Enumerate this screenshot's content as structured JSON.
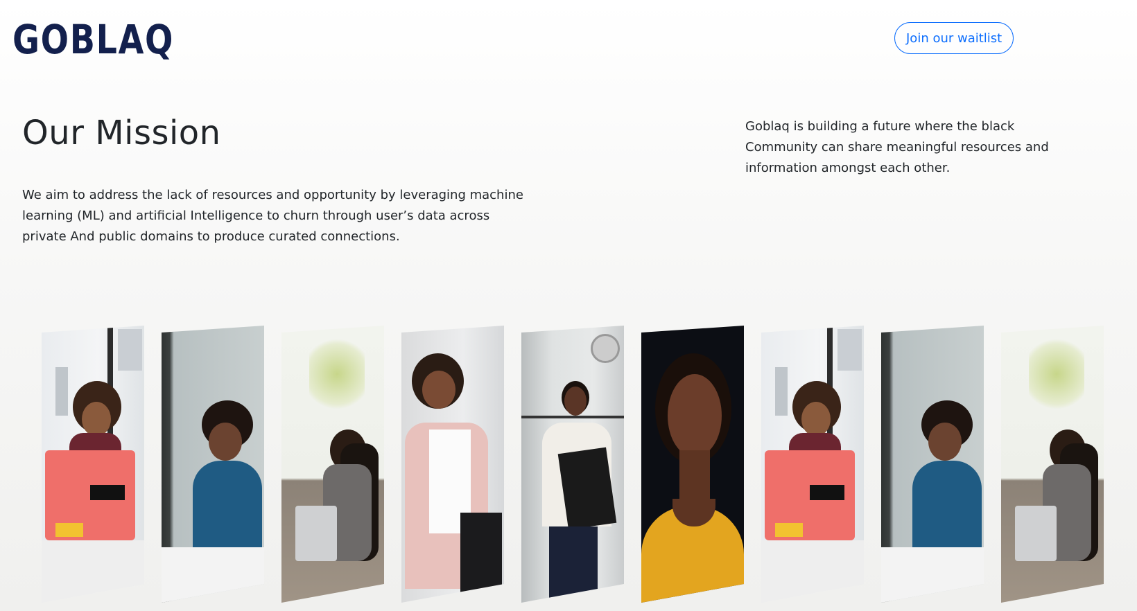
{
  "header": {
    "logo_text": "GOBLAQ",
    "waitlist_label": "Join our waitlist"
  },
  "mission": {
    "title": "Our Mission",
    "body": "We aim to address the lack of resources and opportunity by leveraging machine learning (ML) and artificial Intelligence to churn through user’s data across private And public domains to produce curated connections."
  },
  "vision": {
    "body": "Goblaq is building a future where the black Community can share meaningful resources and information amongst each other."
  },
  "colors": {
    "brand_navy": "#13204d",
    "brand_red": "#e8424f",
    "accent_blue": "#0d6efd"
  },
  "gallery": {
    "photos": [
      {
        "subject": "woman-with-laptop-phone-photo"
      },
      {
        "subject": "woman-at-desk-photo"
      },
      {
        "subject": "woman-on-sofa-laptop-photo"
      },
      {
        "subject": "woman-smiling-phone-photo"
      },
      {
        "subject": "woman-holding-folders-photo"
      },
      {
        "subject": "woman-portrait-photo"
      },
      {
        "subject": "woman-with-laptop-phone-photo"
      },
      {
        "subject": "woman-at-desk-photo"
      },
      {
        "subject": "woman-on-sofa-laptop-photo"
      }
    ]
  }
}
